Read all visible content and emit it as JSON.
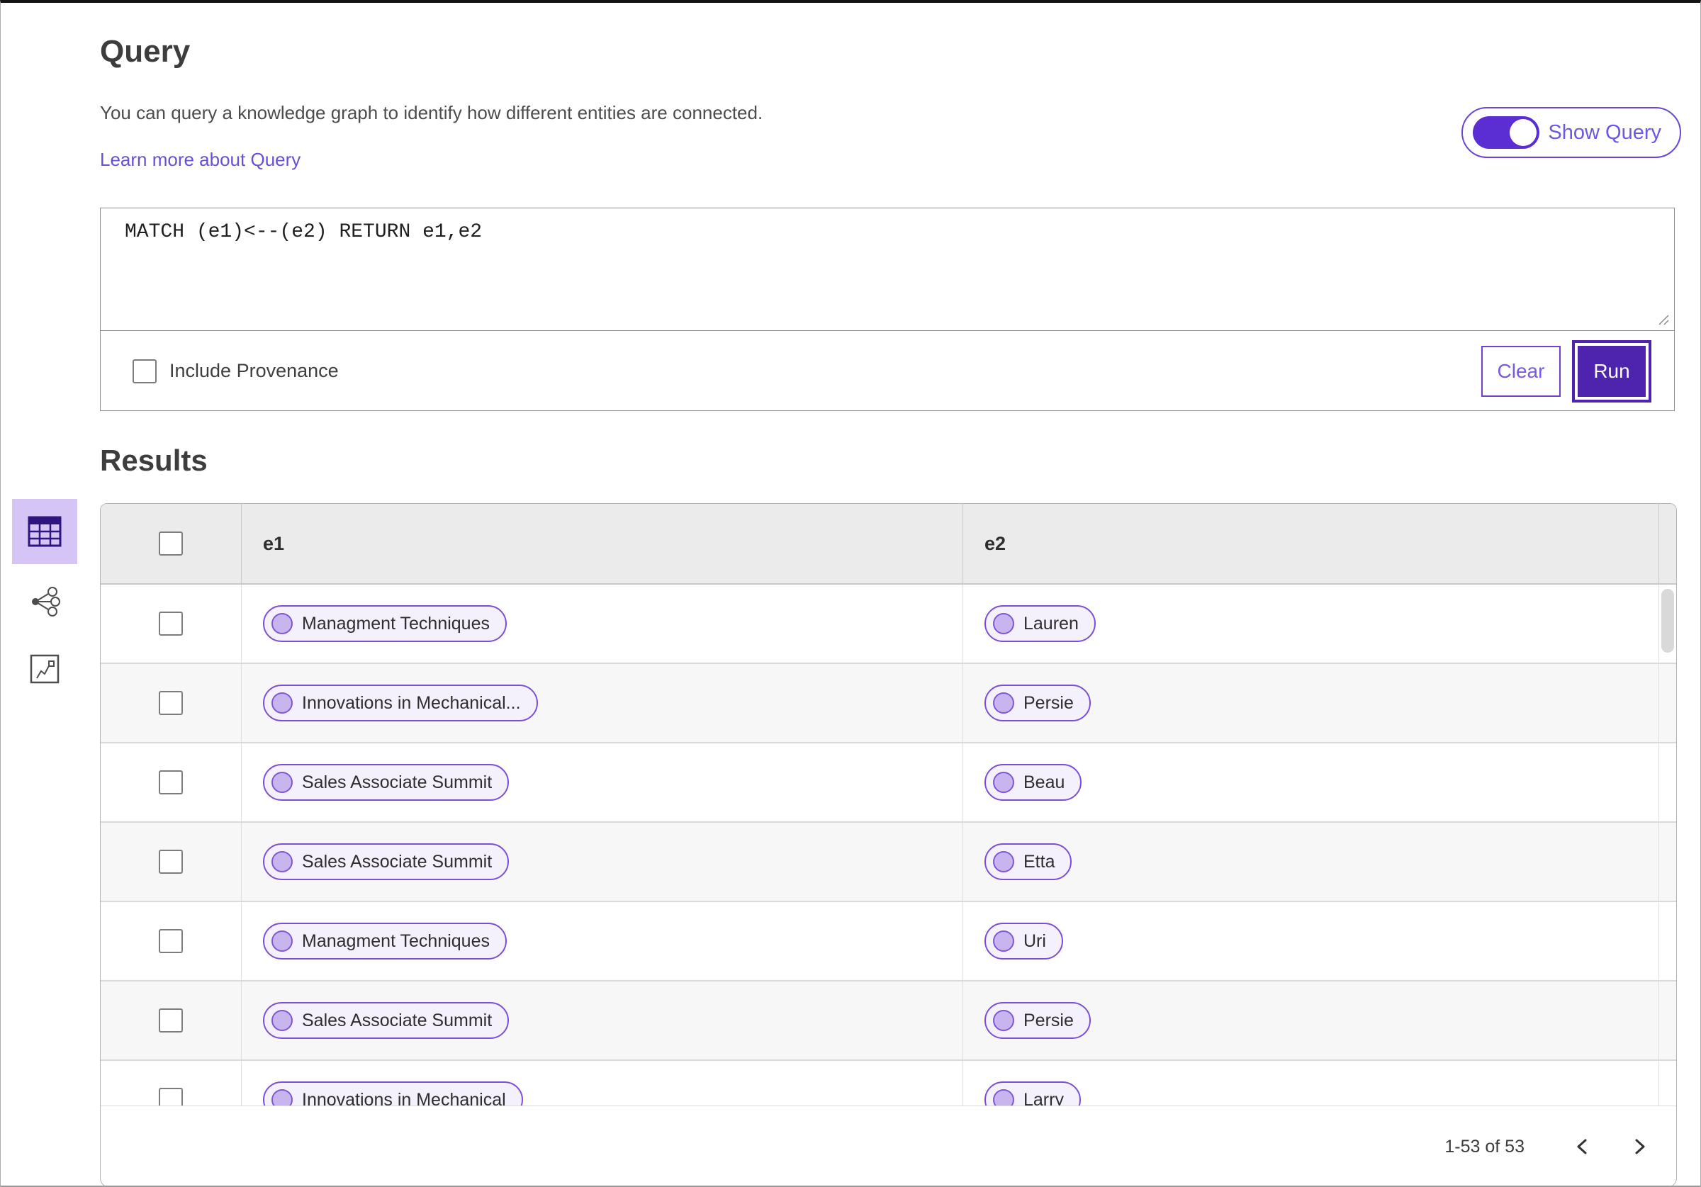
{
  "query_section": {
    "title": "Query",
    "description": "You can query a knowledge graph to identify how different entities are connected.",
    "learn_more_link": "Learn more about Query",
    "show_query_toggle": {
      "label": "Show Query",
      "state": "on"
    },
    "editor": {
      "query_text": "MATCH (e1)<--(e2) RETURN e1,e2"
    },
    "include_provenance": {
      "label": "Include Provenance",
      "checked": false
    },
    "buttons": {
      "clear": "Clear",
      "run": "Run"
    }
  },
  "results_section": {
    "title": "Results",
    "view_switcher": {
      "items": [
        {
          "name": "table-view",
          "selected": true
        },
        {
          "name": "graph-view",
          "selected": false
        },
        {
          "name": "link-chart-view",
          "selected": false
        }
      ]
    },
    "table": {
      "columns": [
        "e1",
        "e2"
      ],
      "rows": [
        {
          "e1": "Managment Techniques",
          "e2": "Lauren"
        },
        {
          "e1": "Innovations in Mechanical...",
          "e2": "Persie"
        },
        {
          "e1": "Sales Associate Summit",
          "e2": "Beau"
        },
        {
          "e1": "Sales Associate Summit",
          "e2": "Etta"
        },
        {
          "e1": "Managment Techniques",
          "e2": "Uri"
        },
        {
          "e1": "Sales Associate Summit",
          "e2": "Persie"
        },
        {
          "e1": "Innovations in Mechanical",
          "e2": "Larry"
        }
      ]
    },
    "pagination": {
      "range_label": "1-53 of 53",
      "prev_icon": "chevron-left",
      "next_icon": "chevron-right"
    }
  },
  "colors": {
    "accent_purple": "#5b2ed3",
    "run_button_bg": "#4e24af",
    "pill_border": "#7b4fd8",
    "pill_bg": "#f5f1fc",
    "pill_dot_fill": "#c8b4ef",
    "selected_view_bg": "#d5c5f6",
    "link_text": "#6551d9",
    "table_header_bg": "#ebebeb",
    "row_alt_bg": "#f7f7f7"
  }
}
